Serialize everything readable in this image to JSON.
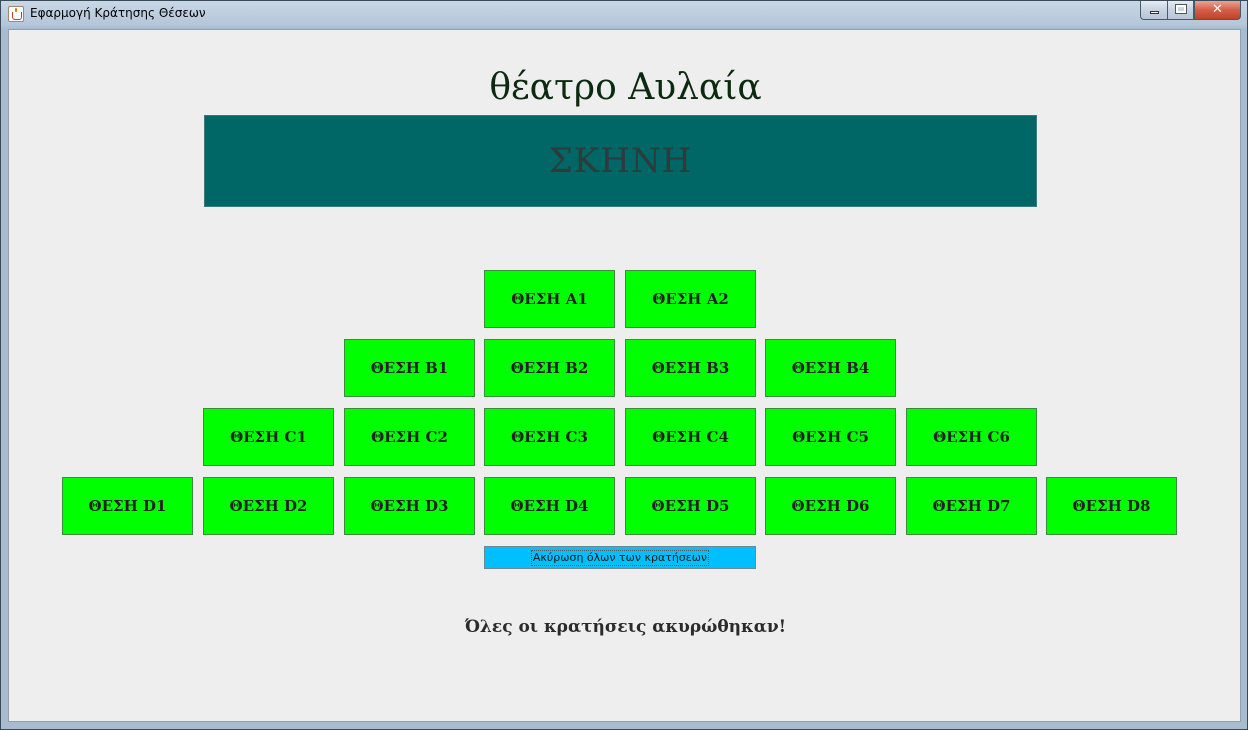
{
  "window": {
    "title": "Εφαρμογή Κράτησης Θέσεων",
    "close_glyph": "✕"
  },
  "theatre": {
    "name": "θέατρο Αυλαία",
    "stage_label": "ΣΚΗΝΗ"
  },
  "seats": {
    "A1": "ΘΕΣΗ A1",
    "A2": "ΘΕΣΗ A2",
    "B1": "ΘΕΣΗ B1",
    "B2": "ΘΕΣΗ B2",
    "B3": "ΘΕΣΗ B3",
    "B4": "ΘΕΣΗ B4",
    "C1": "ΘΕΣΗ C1",
    "C2": "ΘΕΣΗ C2",
    "C3": "ΘΕΣΗ C3",
    "C4": "ΘΕΣΗ C4",
    "C5": "ΘΕΣΗ C5",
    "C6": "ΘΕΣΗ C6",
    "D1": "ΘΕΣΗ D1",
    "D2": "ΘΕΣΗ D2",
    "D3": "ΘΕΣΗ D3",
    "D4": "ΘΕΣΗ D4",
    "D5": "ΘΕΣΗ D5",
    "D6": "ΘΕΣΗ D6",
    "D7": "ΘΕΣΗ D7",
    "D8": "ΘΕΣΗ D8"
  },
  "cancel_all_label": "Ακύρωση όλων των κρατήσεων",
  "status_message": "Όλες οι κρατήσεις ακυρώθηκαν!",
  "colors": {
    "seat_available": "#00ff00",
    "stage": "#006666",
    "cancel_button": "#00bfff",
    "background": "#eeeeee"
  }
}
